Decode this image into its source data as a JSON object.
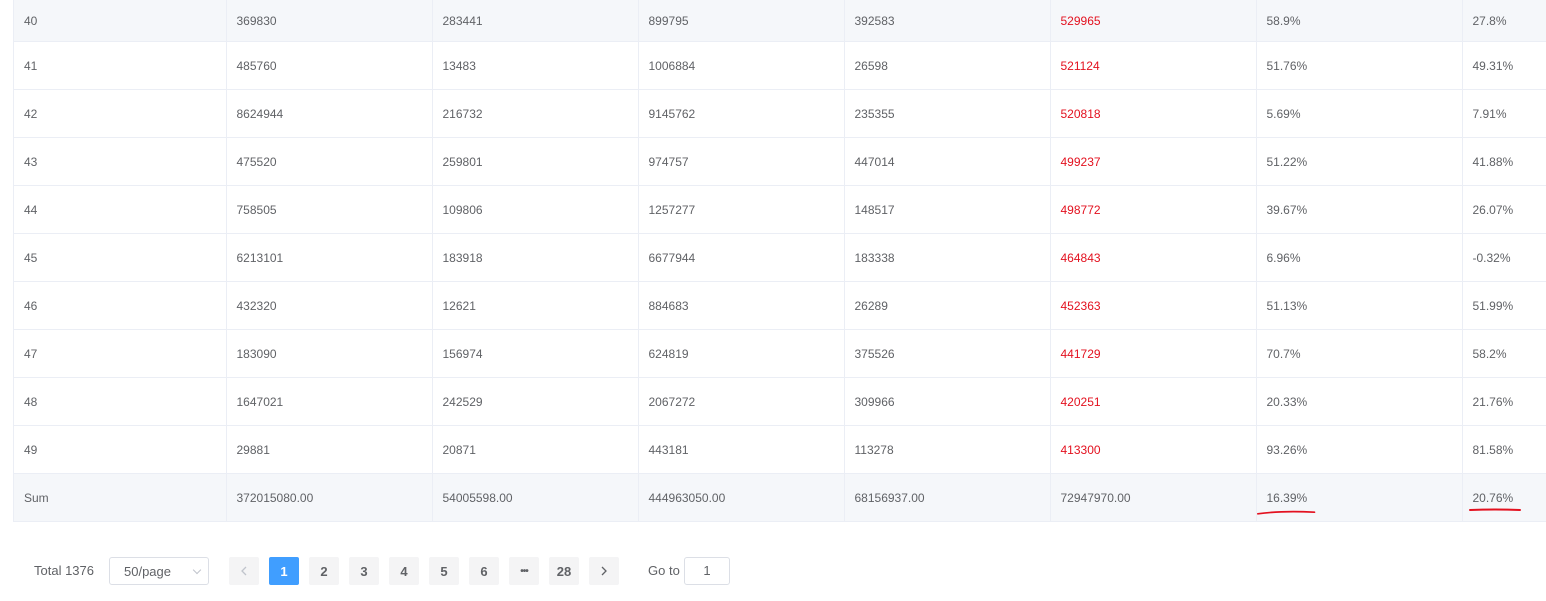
{
  "table": {
    "highlight_color": "#e3111f",
    "rows": [
      [
        "40",
        "369830",
        "283441",
        "899795",
        "392583",
        "529965",
        "58.9%",
        "27.8%"
      ],
      [
        "41",
        "485760",
        "13483",
        "1006884",
        "26598",
        "521124",
        "51.76%",
        "49.31%"
      ],
      [
        "42",
        "8624944",
        "216732",
        "9145762",
        "235355",
        "520818",
        "5.69%",
        "7.91%"
      ],
      [
        "43",
        "475520",
        "259801",
        "974757",
        "447014",
        "499237",
        "51.22%",
        "41.88%"
      ],
      [
        "44",
        "758505",
        "109806",
        "1257277",
        "148517",
        "498772",
        "39.67%",
        "26.07%"
      ],
      [
        "45",
        "6213101",
        "183918",
        "6677944",
        "183338",
        "464843",
        "6.96%",
        "-0.32%"
      ],
      [
        "46",
        "432320",
        "12621",
        "884683",
        "26289",
        "452363",
        "51.13%",
        "51.99%"
      ],
      [
        "47",
        "183090",
        "156974",
        "624819",
        "375526",
        "441729",
        "70.7%",
        "58.2%"
      ],
      [
        "48",
        "1647021",
        "242529",
        "2067272",
        "309966",
        "420251",
        "20.33%",
        "21.76%"
      ],
      [
        "49",
        "29881",
        "20871",
        "443181",
        "113278",
        "413300",
        "93.26%",
        "81.58%"
      ]
    ],
    "sum_row": [
      "Sum",
      "372015080.00",
      "54005598.00",
      "444963050.00",
      "68156937.00",
      "72947970.00",
      "16.39%",
      "20.76%"
    ]
  },
  "annotation": {
    "underline_color": "#e3111f"
  },
  "pagination": {
    "total_label": "Total 1376",
    "page_size": "50/page",
    "prev_icon": "chevron-left-icon",
    "pages": [
      "1",
      "2",
      "3",
      "4",
      "5",
      "6"
    ],
    "more_icon": "ellipsis-icon",
    "more_label": "•••",
    "last_page": "28",
    "next_icon": "chevron-right-icon",
    "current_page": "1",
    "goto_label": "Go to",
    "goto_value": "1",
    "active_color": "#409eff"
  }
}
